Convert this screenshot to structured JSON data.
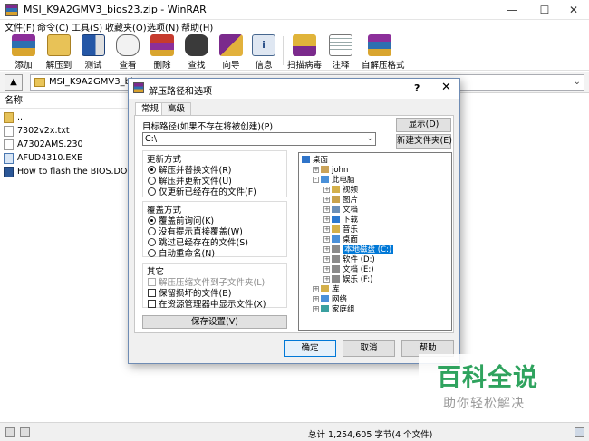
{
  "window": {
    "title": "MSI_K9A2GMV3_bios23.zip - WinRAR"
  },
  "menu": [
    "文件(F)",
    "命令(C)",
    "工具(S)",
    "收藏夹(O)",
    "选项(N)",
    "帮助(H)"
  ],
  "toolbar": [
    "添加",
    "解压到",
    "测试",
    "查看",
    "删除",
    "查找",
    "向导",
    "信息",
    "扫描病毒",
    "注释",
    "自解压格式"
  ],
  "address": {
    "path": "MSI_K9A2GMV3_bios"
  },
  "filelist": {
    "column_name": "名称",
    "files": [
      "..",
      "7302v2x.txt",
      "A7302AMS.230",
      "AFUD4310.EXE",
      "How to flash the BIOS.DOC"
    ]
  },
  "status": {
    "text": "总计 1,254,605 字节(4 个文件)"
  },
  "dialog": {
    "title": "解压路径和选项",
    "help_glyph": "?",
    "close_glyph": "✕",
    "tabs": [
      "常规",
      "高级"
    ],
    "dest_label": "目标路径(如果不存在将被创建)(P)",
    "dest_value": "C:\\",
    "show_button": "显示(D)",
    "new_folder_button": "新建文件夹(E)",
    "update_group": {
      "title": "更新方式",
      "options": [
        "解压并替换文件(R)",
        "解压并更新文件(U)",
        "仅更新已经存在的文件(F)"
      ],
      "selected": 0
    },
    "overwrite_group": {
      "title": "覆盖方式",
      "options": [
        "覆盖前询问(K)",
        "没有提示直接覆盖(W)",
        "跳过已经存在的文件(S)",
        "自动重命名(N)"
      ],
      "selected": 0
    },
    "misc_group": {
      "title": "其它",
      "options": [
        "解压压缩文件到子文件夹(L)",
        "保留损坏的文件(B)",
        "在资源管理器中显示文件(X)"
      ],
      "disabled": [
        true,
        false,
        false
      ]
    },
    "save_button": "保存设置(V)",
    "tree": [
      {
        "label": "桌面",
        "level": 0,
        "exp": ""
      },
      {
        "label": "john",
        "level": 1,
        "exp": "+"
      },
      {
        "label": "此电脑",
        "level": 1,
        "exp": "-"
      },
      {
        "label": "视频",
        "level": 2,
        "exp": "+"
      },
      {
        "label": "图片",
        "level": 2,
        "exp": "+"
      },
      {
        "label": "文档",
        "level": 2,
        "exp": "+"
      },
      {
        "label": "下载",
        "level": 2,
        "exp": "+"
      },
      {
        "label": "音乐",
        "level": 2,
        "exp": "+"
      },
      {
        "label": "桌面",
        "level": 2,
        "exp": "+"
      },
      {
        "label": "本地磁盘 (C:)",
        "level": 2,
        "exp": "+",
        "selected": true
      },
      {
        "label": "软件 (D:)",
        "level": 2,
        "exp": "+"
      },
      {
        "label": "文档 (E:)",
        "level": 2,
        "exp": "+"
      },
      {
        "label": "娱乐 (F:)",
        "level": 2,
        "exp": "+"
      },
      {
        "label": "库",
        "level": 1,
        "exp": "+"
      },
      {
        "label": "网络",
        "level": 1,
        "exp": "+"
      },
      {
        "label": "家庭组",
        "level": 1,
        "exp": "+"
      }
    ],
    "ok_button": "确定",
    "cancel_button": "取消",
    "help_button": "帮助"
  },
  "watermark": {
    "main": "百科全说",
    "sub": "助你轻松解决"
  },
  "colors": {
    "accent": "#0078d7",
    "watermark": "#2fa35e"
  }
}
